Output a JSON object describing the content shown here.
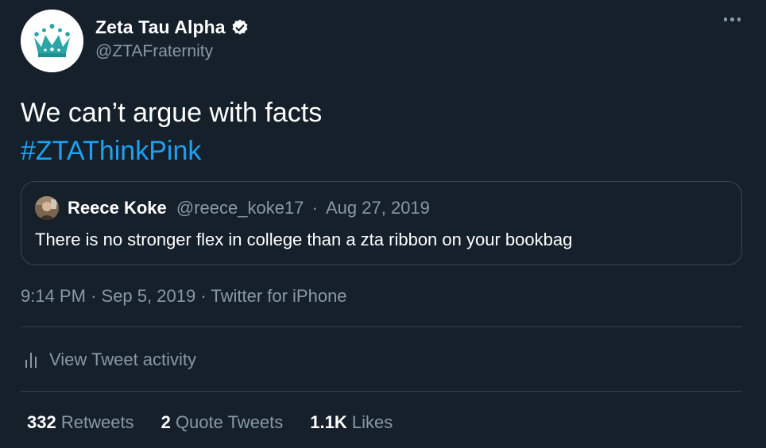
{
  "author": {
    "name": "Zeta Tau Alpha",
    "handle": "@ZTAFraternity",
    "verified": true,
    "avatar_icon": "crown-icon",
    "brand_color": "#2aa6a6"
  },
  "tweet": {
    "text": "We can’t argue with facts",
    "hashtag": "#ZTAThinkPink"
  },
  "quoted": {
    "name": "Reece Koke",
    "handle": "@reece_koke17",
    "separator": "·",
    "date": "Aug 27, 2019",
    "text": "There is no stronger flex in college than a zta ribbon on your bookbag"
  },
  "meta": {
    "time": "9:14 PM",
    "sep1": "·",
    "date": "Sep 5, 2019",
    "sep2": "·",
    "source": "Twitter for iPhone"
  },
  "activity": {
    "label": "View Tweet activity",
    "icon": "analytics-bars-icon"
  },
  "stats": {
    "retweets_count": "332",
    "retweets_label": "Retweets",
    "quotes_count": "2",
    "quotes_label": "Quote Tweets",
    "likes_count": "1.1K",
    "likes_label": "Likes"
  },
  "colors": {
    "background": "#15202b",
    "text": "#ffffff",
    "secondary": "#8899a6",
    "link": "#1da1f2",
    "border": "#38444d"
  }
}
